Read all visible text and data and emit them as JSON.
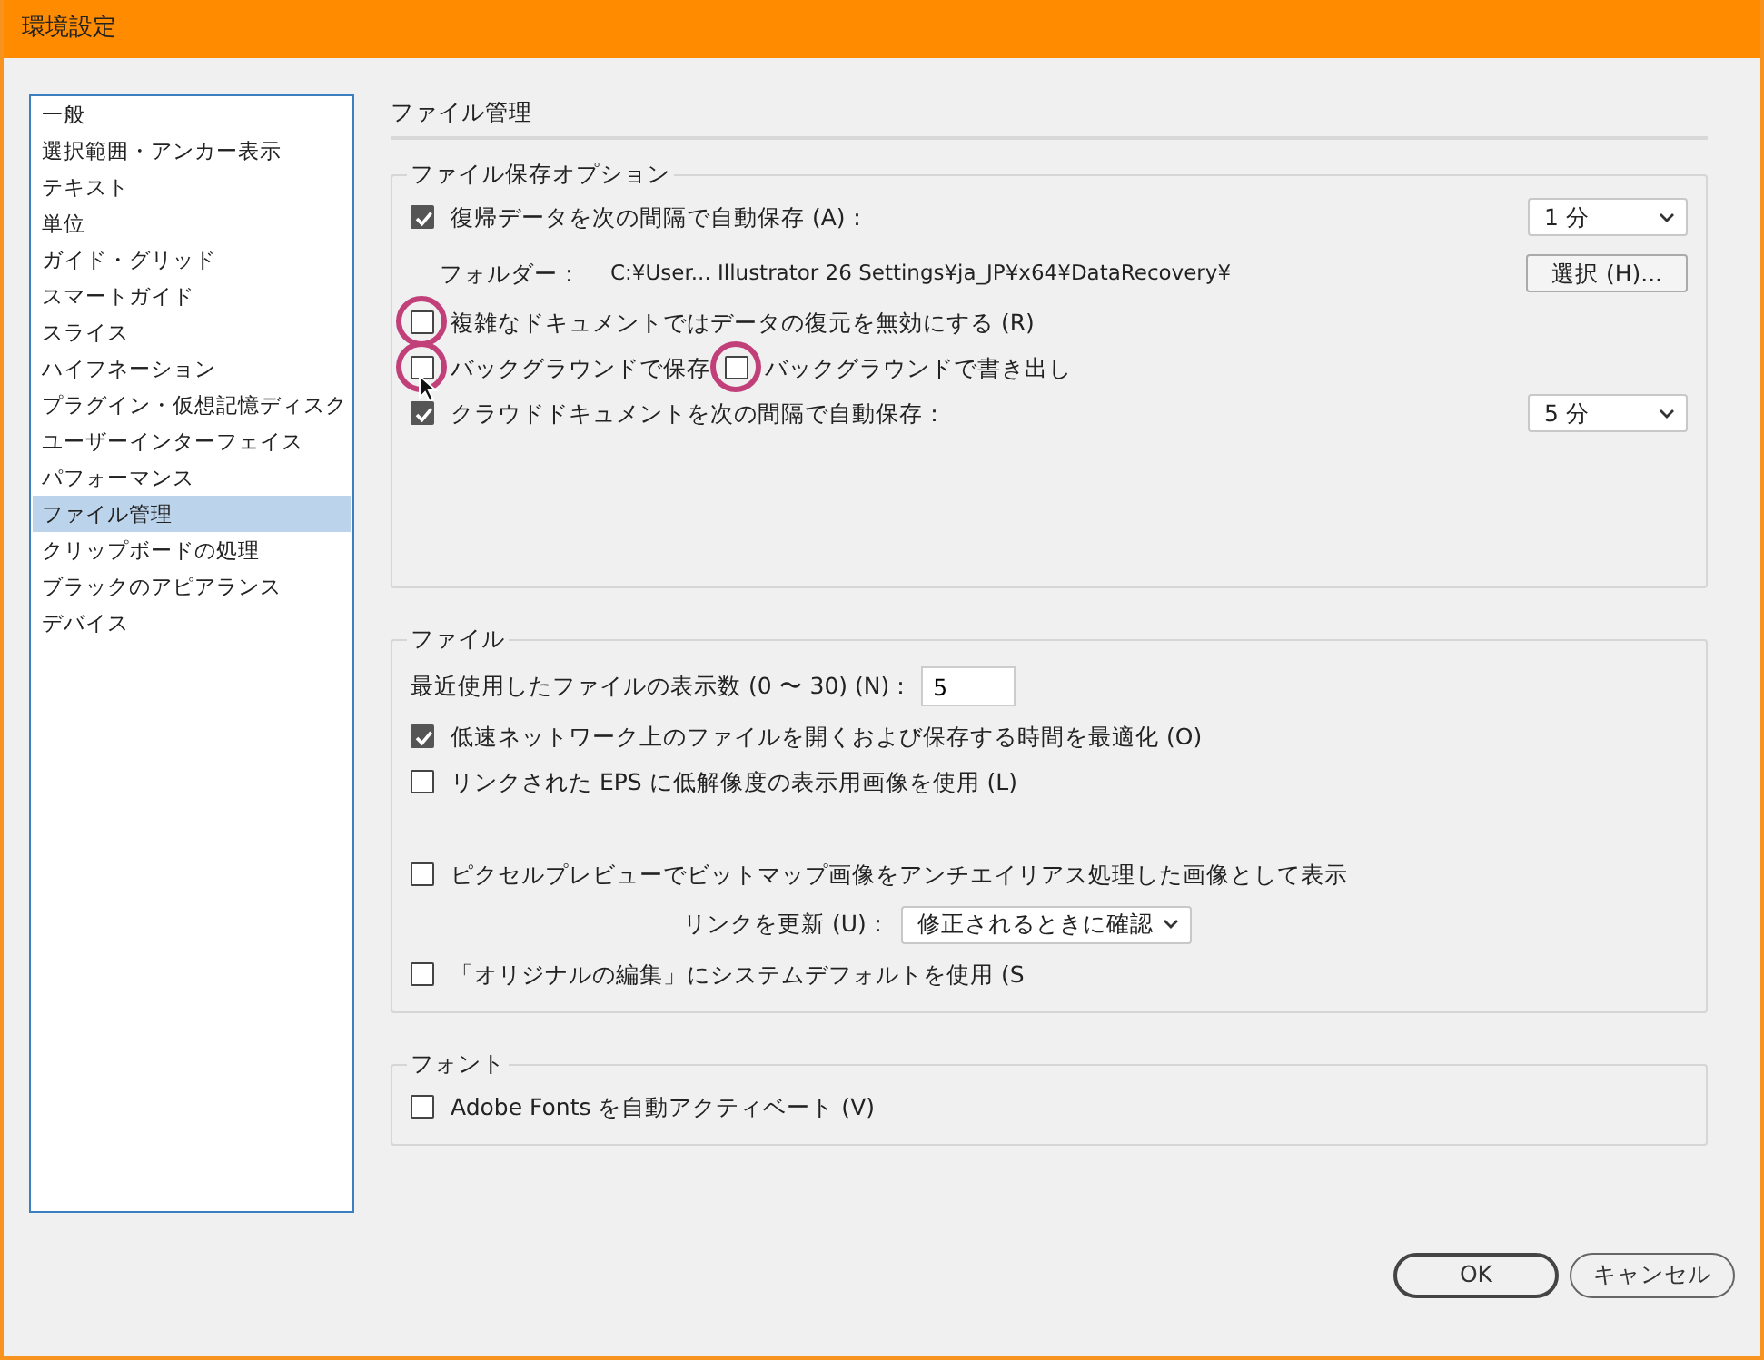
{
  "window": {
    "title": "環境設定"
  },
  "sidebar": {
    "items": [
      {
        "label": "一般",
        "selected": false
      },
      {
        "label": "選択範囲・アンカー表示",
        "selected": false
      },
      {
        "label": "テキスト",
        "selected": false
      },
      {
        "label": "単位",
        "selected": false
      },
      {
        "label": "ガイド・グリッド",
        "selected": false
      },
      {
        "label": "スマートガイド",
        "selected": false
      },
      {
        "label": "スライス",
        "selected": false
      },
      {
        "label": "ハイフネーション",
        "selected": false
      },
      {
        "label": "プラグイン・仮想記憶ディスク",
        "selected": false
      },
      {
        "label": "ユーザーインターフェイス",
        "selected": false
      },
      {
        "label": "パフォーマンス",
        "selected": false
      },
      {
        "label": "ファイル管理",
        "selected": true
      },
      {
        "label": "クリップボードの処理",
        "selected": false
      },
      {
        "label": "ブラックのアピアランス",
        "selected": false
      },
      {
        "label": "デバイス",
        "selected": false
      }
    ]
  },
  "panel": {
    "heading": "ファイル管理",
    "groups": [
      {
        "title": "ファイル保存オプション",
        "rows": [
          {
            "kind": "checkbox",
            "label": "復帰データを次の間隔で自動保存 (A)：",
            "checked": true,
            "dropdown": "1 分"
          },
          {
            "kind": "path",
            "label": "フォルダー：",
            "value": "C:¥User... Illustrator 26 Settings¥ja_JP¥x64¥DataRecovery¥",
            "button": "選択 (H)..."
          },
          {
            "kind": "checkbox",
            "label": "複雑なドキュメントではデータの復元を無効にする (R)",
            "checked": false,
            "circled": true
          },
          {
            "kind": "pair",
            "items": [
              {
                "label": "バックグラウンドで保存",
                "checked": false,
                "circled": true,
                "cursor": true
              },
              {
                "label": "バックグラウンドで書き出し",
                "checked": false,
                "circled": true
              }
            ]
          },
          {
            "kind": "checkbox",
            "label": "クラウドドキュメントを次の間隔で自動保存：",
            "checked": true,
            "dropdown": "5 分"
          }
        ]
      },
      {
        "title": "ファイル",
        "rows": [
          {
            "kind": "number",
            "label": "最近使用したファイルの表示数 (0 〜 30) (N)：",
            "value": "5"
          },
          {
            "kind": "checkbox",
            "label": "低速ネットワーク上のファイルを開くおよび保存する時間を最適化 (O)",
            "checked": true
          },
          {
            "kind": "checkbox",
            "label": "リンクされた EPS に低解像度の表示用画像を使用 (L)",
            "checked": false
          },
          {
            "kind": "spacer"
          },
          {
            "kind": "checkbox",
            "label": "ピクセルプレビューでビットマップ画像をアンチエイリアス処理した画像として表示",
            "checked": false
          },
          {
            "kind": "select",
            "label": "リンクを更新 (U)：",
            "value": "修正されるときに確認"
          },
          {
            "kind": "checkbox",
            "label": "「オリジナルの編集」にシステムデフォルトを使用 (S",
            "checked": false
          }
        ]
      },
      {
        "title": "フォント",
        "rows": [
          {
            "kind": "checkbox",
            "label": "Adobe Fonts を自動アクティベート (V)",
            "checked": false
          }
        ]
      }
    ]
  },
  "buttons": [
    {
      "label": "OK",
      "default": true
    },
    {
      "label": "キャンセル",
      "default": false
    }
  ]
}
